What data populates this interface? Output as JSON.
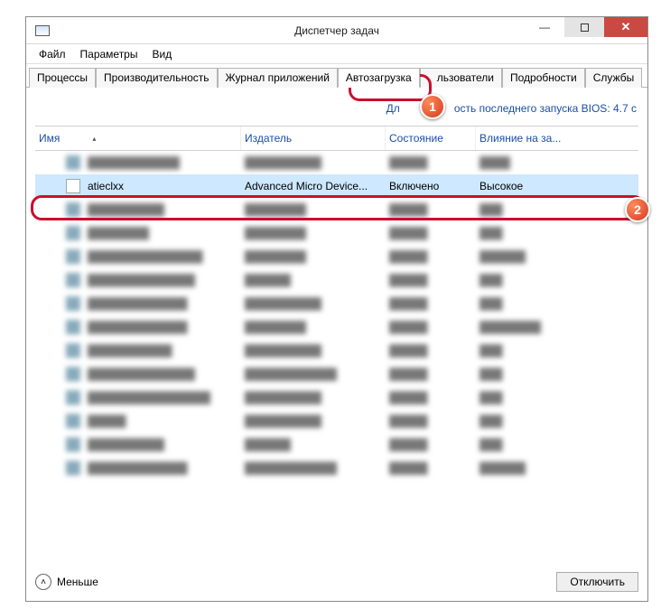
{
  "window": {
    "title": "Диспетчер задач"
  },
  "menu": {
    "file": "Файл",
    "options": "Параметры",
    "view": "Вид"
  },
  "tabs": {
    "processes": "Процессы",
    "performance": "Производительность",
    "apphistory": "Журнал приложений",
    "startup": "Автозагрузка",
    "users_frag": "льзователи",
    "details": "Подробности",
    "services": "Службы"
  },
  "bios": {
    "prefix": "Дл",
    "suffix": "ость последнего запуска BIOS: 4.7 с"
  },
  "columns": {
    "name": "Имя",
    "publisher": "Издатель",
    "state": "Состояние",
    "impact": "Влияние на за..."
  },
  "row": {
    "name": "atieclxx",
    "publisher": "Advanced Micro Device...",
    "state": "Включено",
    "impact": "Высокое"
  },
  "footer": {
    "fewer": "Меньше",
    "disable": "Отключить"
  },
  "callouts": {
    "one": "1",
    "two": "2"
  }
}
